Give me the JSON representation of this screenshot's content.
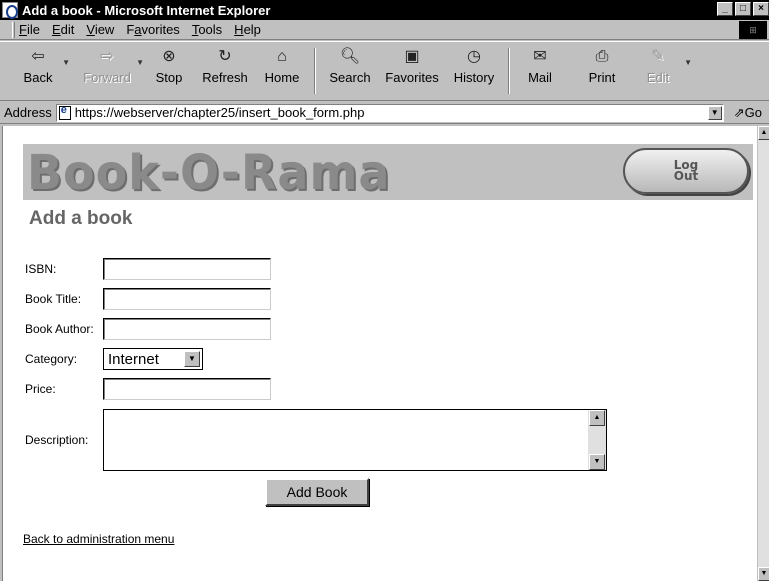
{
  "window": {
    "title": "Add a book - Microsoft Internet Explorer",
    "controls": [
      "_",
      "□",
      "×"
    ]
  },
  "menu": {
    "items": [
      {
        "label": "File",
        "u": "F"
      },
      {
        "label": "Edit",
        "u": "E"
      },
      {
        "label": "View",
        "u": "V"
      },
      {
        "label": "Favorites",
        "u": "a"
      },
      {
        "label": "Tools",
        "u": "T"
      },
      {
        "label": "Help",
        "u": "H"
      }
    ]
  },
  "toolbar": {
    "back": "Back",
    "forward": "Forward",
    "stop": "Stop",
    "refresh": "Refresh",
    "home": "Home",
    "search": "Search",
    "favorites": "Favorites",
    "history": "History",
    "mail": "Mail",
    "print": "Print",
    "edit": "Edit"
  },
  "address": {
    "label": "Address",
    "url": "https://webserver/chapter25/insert_book_form.php",
    "go": "Go"
  },
  "page": {
    "logo": "Book-O-Rama",
    "logout_line1": "Log",
    "logout_line2": "Out",
    "title": "Add a book"
  },
  "form": {
    "isbn_label": "ISBN:",
    "isbn_value": "",
    "title_label": "Book Title:",
    "title_value": "",
    "author_label": "Book Author:",
    "author_value": "",
    "category_label": "Category:",
    "category_value": "Internet",
    "price_label": "Price:",
    "price_value": "",
    "description_label": "Description:",
    "description_value": "",
    "submit_label": "Add Book"
  },
  "links": {
    "back": "Back to administration menu"
  },
  "colors": {
    "titlebar": "#000000",
    "chrome": "#c0c0c0",
    "banner": "#c0c0c0",
    "logo": "#8a8a8a",
    "page_title": "#666666"
  }
}
